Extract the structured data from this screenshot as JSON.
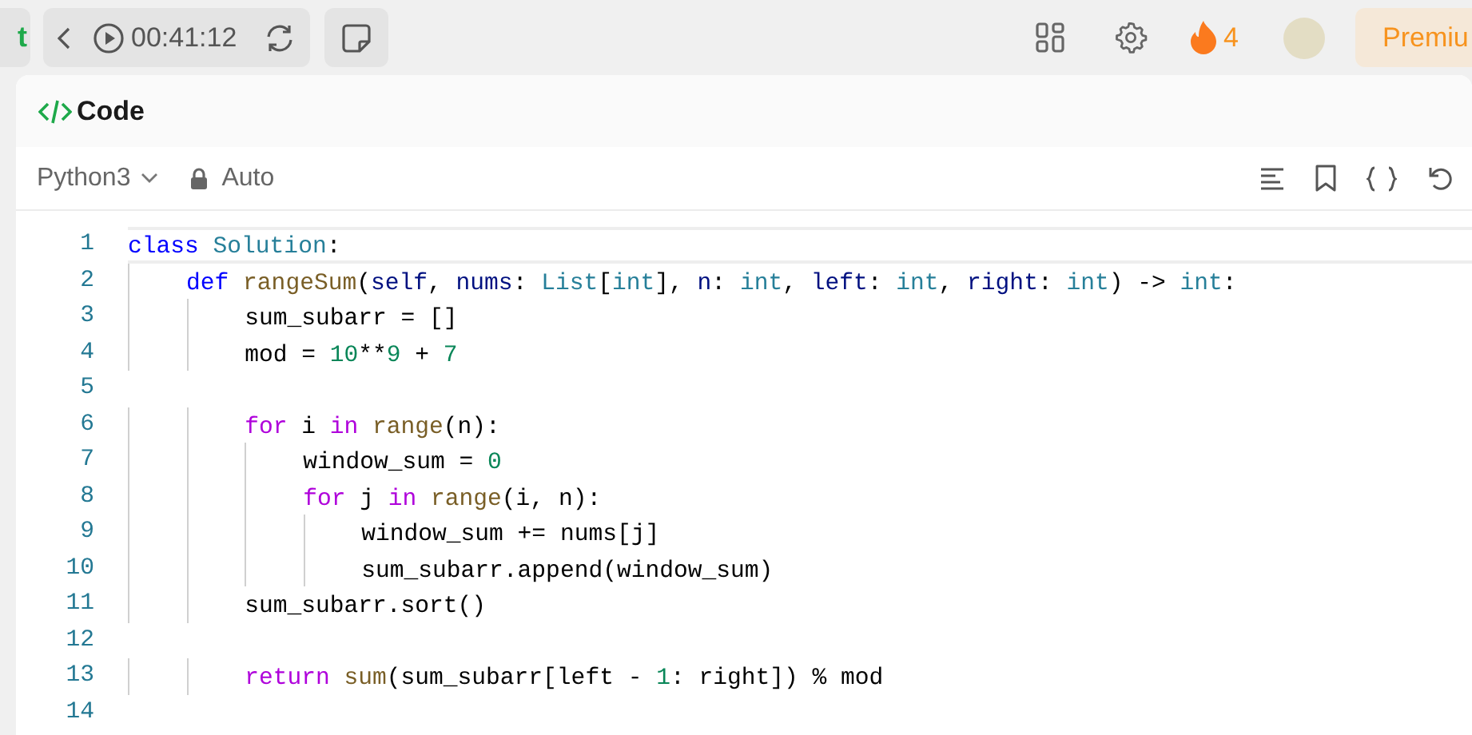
{
  "top_bar": {
    "left_cut_button": "t",
    "timer": "00:41:12",
    "streak": "4",
    "premium_button": "Premiu"
  },
  "panel": {
    "title": "Code",
    "language": "Python3",
    "mode": "Auto"
  },
  "editor": {
    "lines": [
      {
        "number": "1",
        "current": true,
        "tokens": [
          {
            "text": "class",
            "kind": "keyword"
          },
          {
            "text": " Solution",
            "kind": "type"
          },
          {
            "text": ":"
          }
        ]
      },
      {
        "number": "2",
        "current": false,
        "tokens": [
          {
            "text": "    def",
            "kind": "keyword"
          },
          {
            "text": " rangeSum",
            "kind": "function"
          },
          {
            "text": "("
          },
          {
            "text": "self",
            "kind": "variable"
          },
          {
            "text": ", "
          },
          {
            "text": "nums",
            "kind": "variable"
          },
          {
            "text": ": "
          },
          {
            "text": "List",
            "kind": "type"
          },
          {
            "text": "["
          },
          {
            "text": "int",
            "kind": "type"
          },
          {
            "text": "], "
          },
          {
            "text": "n",
            "kind": "variable"
          },
          {
            "text": ": "
          },
          {
            "text": "int",
            "kind": "type"
          },
          {
            "text": ", "
          },
          {
            "text": "left",
            "kind": "variable"
          },
          {
            "text": ": "
          },
          {
            "text": "int",
            "kind": "type"
          },
          {
            "text": ", "
          },
          {
            "text": "right",
            "kind": "variable"
          },
          {
            "text": ": "
          },
          {
            "text": "int",
            "kind": "type"
          },
          {
            "text": ") -> "
          },
          {
            "text": "int",
            "kind": "type"
          },
          {
            "text": ":"
          }
        ]
      },
      {
        "number": "3",
        "current": false,
        "tokens": [
          {
            "text": "        sum_subarr = []"
          }
        ]
      },
      {
        "number": "4",
        "current": false,
        "tokens": [
          {
            "text": "        mod = "
          },
          {
            "text": "10",
            "kind": "number"
          },
          {
            "text": "**"
          },
          {
            "text": "9",
            "kind": "number"
          },
          {
            "text": " + "
          },
          {
            "text": "7",
            "kind": "number"
          }
        ]
      },
      {
        "number": "5",
        "current": false
      },
      {
        "number": "6",
        "current": false,
        "tokens": [
          {
            "text": "        for",
            "kind": "control"
          },
          {
            "text": " i "
          },
          {
            "text": "in",
            "kind": "control"
          },
          {
            "text": " range",
            "kind": "function"
          },
          {
            "text": "(n):"
          }
        ]
      },
      {
        "number": "7",
        "current": false,
        "tokens": [
          {
            "text": "            window_sum = "
          },
          {
            "text": "0",
            "kind": "number"
          }
        ]
      },
      {
        "number": "8",
        "current": false,
        "tokens": [
          {
            "text": "            for",
            "kind": "control"
          },
          {
            "text": " j "
          },
          {
            "text": "in",
            "kind": "control"
          },
          {
            "text": " range",
            "kind": "function"
          },
          {
            "text": "(i, n):"
          }
        ]
      },
      {
        "number": "9",
        "current": false,
        "tokens": [
          {
            "text": "                window_sum += nums[j]"
          }
        ]
      },
      {
        "number": "10",
        "current": false,
        "tokens": [
          {
            "text": "                sum_subarr.append(window_sum)"
          }
        ]
      },
      {
        "number": "11",
        "current": false,
        "tokens": [
          {
            "text": "        sum_subarr.sort()"
          }
        ]
      },
      {
        "number": "12",
        "current": false
      },
      {
        "number": "13",
        "current": false,
        "tokens": [
          {
            "text": "        return",
            "kind": "control"
          },
          {
            "text": " sum",
            "kind": "function"
          },
          {
            "text": "(sum_subarr[left - "
          },
          {
            "text": "1",
            "kind": "number"
          },
          {
            "text": ": right]) % mod"
          }
        ]
      },
      {
        "number": "14",
        "current": false
      }
    ]
  }
}
